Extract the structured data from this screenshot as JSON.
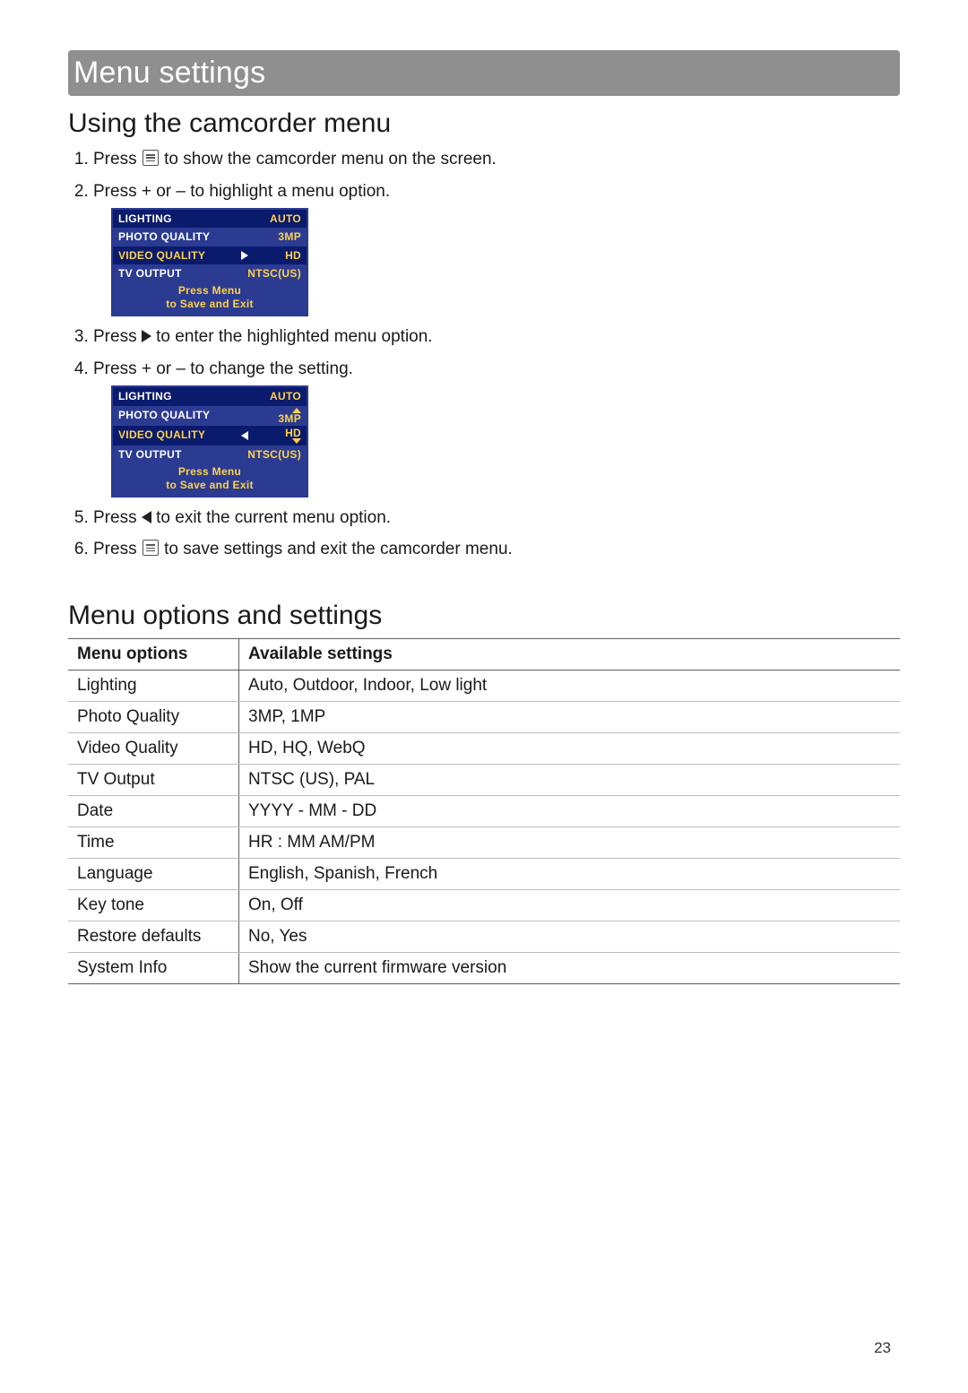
{
  "banner_title": "Menu settings",
  "section1_title": "Using the camcorder menu",
  "section2_title": "Menu options and settings",
  "page_number": "23",
  "steps": {
    "s1a": "Press ",
    "s1b": " to show the camcorder menu on the screen.",
    "s2": "Press + or – to highlight a menu option.",
    "s3a": "Press ",
    "s3b": " to enter the highlighted menu option.",
    "s4": "Press + or – to change the setting.",
    "s5a": "Press ",
    "s5b": " to exit the current menu option.",
    "s6a": "Press ",
    "s6b": " to save settings and exit the camcorder menu."
  },
  "osd": {
    "rows": [
      {
        "label": "LIGHTING",
        "value": "AUTO"
      },
      {
        "label": "PHOTO QUALITY",
        "value": "3MP"
      },
      {
        "label": "VIDEO QUALITY",
        "value": "HD"
      },
      {
        "label": "TV OUTPUT",
        "value": "NTSC(US)"
      }
    ],
    "footer_line1": "Press Menu",
    "footer_line2": "to Save and Exit"
  },
  "table": {
    "head_option": "Menu options",
    "head_settings": "Available settings",
    "rows": [
      {
        "opt": "Lighting",
        "val": "Auto, Outdoor, Indoor, Low light"
      },
      {
        "opt": "Photo Quality",
        "val": "3MP, 1MP"
      },
      {
        "opt": "Video Quality",
        "val": "HD, HQ, WebQ"
      },
      {
        "opt": "TV Output",
        "val": "NTSC (US), PAL"
      },
      {
        "opt": "Date",
        "val": "YYYY - MM - DD"
      },
      {
        "opt": "Time",
        "val": "HR : MM AM/PM"
      },
      {
        "opt": "Language",
        "val": "English, Spanish, French"
      },
      {
        "opt": "Key tone",
        "val": "On, Off"
      },
      {
        "opt": "Restore defaults",
        "val": "No, Yes"
      },
      {
        "opt": "System Info",
        "val": "Show the current firmware version"
      }
    ]
  }
}
